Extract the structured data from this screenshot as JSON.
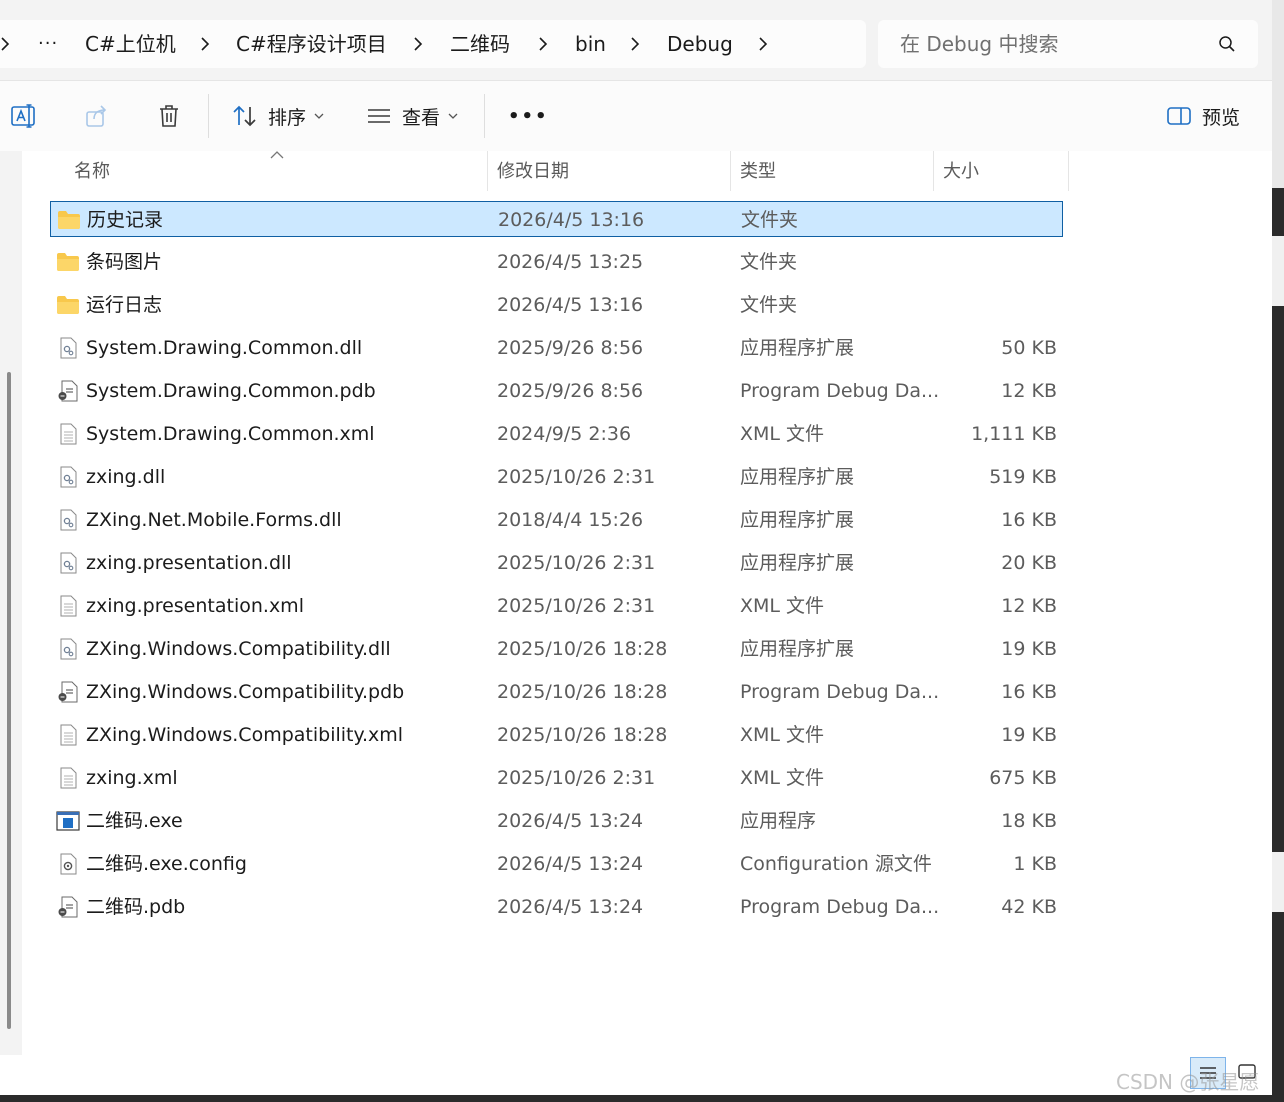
{
  "address_bar": {
    "crumbs": [
      "C#上位机",
      "C#程序设计项目",
      "二维码",
      "bin",
      "Debug"
    ],
    "overflow": "···"
  },
  "search": {
    "placeholder": "在 Debug 中搜索"
  },
  "toolbar": {
    "sort_label": "排序",
    "view_label": "查看",
    "more_label": "•••",
    "preview_label": "预览"
  },
  "columns": {
    "name": "名称",
    "date": "修改日期",
    "type": "类型",
    "size": "大小"
  },
  "files": [
    {
      "icon": "folder-icon",
      "name": "历史记录",
      "date": "2026/4/5 13:16",
      "type": "文件夹",
      "size": "",
      "selected": true
    },
    {
      "icon": "folder-icon",
      "name": "条码图片",
      "date": "2026/4/5 13:25",
      "type": "文件夹",
      "size": ""
    },
    {
      "icon": "folder-icon",
      "name": "运行日志",
      "date": "2026/4/5 13:16",
      "type": "文件夹",
      "size": ""
    },
    {
      "icon": "dll-file-icon",
      "name": "System.Drawing.Common.dll",
      "date": "2025/9/26 8:56",
      "type": "应用程序扩展",
      "size": "50 KB"
    },
    {
      "icon": "pdb-file-icon",
      "name": "System.Drawing.Common.pdb",
      "date": "2025/9/26 8:56",
      "type": "Program Debug Da...",
      "size": "12 KB"
    },
    {
      "icon": "text-file-icon",
      "name": "System.Drawing.Common.xml",
      "date": "2024/9/5 2:36",
      "type": "XML 文件",
      "size": "1,111 KB"
    },
    {
      "icon": "dll-file-icon",
      "name": "zxing.dll",
      "date": "2025/10/26 2:31",
      "type": "应用程序扩展",
      "size": "519 KB"
    },
    {
      "icon": "dll-file-icon",
      "name": "ZXing.Net.Mobile.Forms.dll",
      "date": "2018/4/4 15:26",
      "type": "应用程序扩展",
      "size": "16 KB"
    },
    {
      "icon": "dll-file-icon",
      "name": "zxing.presentation.dll",
      "date": "2025/10/26 2:31",
      "type": "应用程序扩展",
      "size": "20 KB"
    },
    {
      "icon": "text-file-icon",
      "name": "zxing.presentation.xml",
      "date": "2025/10/26 2:31",
      "type": "XML 文件",
      "size": "12 KB"
    },
    {
      "icon": "dll-file-icon",
      "name": "ZXing.Windows.Compatibility.dll",
      "date": "2025/10/26 18:28",
      "type": "应用程序扩展",
      "size": "19 KB"
    },
    {
      "icon": "pdb-file-icon",
      "name": "ZXing.Windows.Compatibility.pdb",
      "date": "2025/10/26 18:28",
      "type": "Program Debug Da...",
      "size": "16 KB"
    },
    {
      "icon": "text-file-icon",
      "name": "ZXing.Windows.Compatibility.xml",
      "date": "2025/10/26 18:28",
      "type": "XML 文件",
      "size": "19 KB"
    },
    {
      "icon": "text-file-icon",
      "name": "zxing.xml",
      "date": "2025/10/26 2:31",
      "type": "XML 文件",
      "size": "675 KB"
    },
    {
      "icon": "exe-file-icon",
      "name": "二维码.exe",
      "date": "2026/4/5 13:24",
      "type": "应用程序",
      "size": "18 KB"
    },
    {
      "icon": "config-file-icon",
      "name": "二维码.exe.config",
      "date": "2026/4/5 13:24",
      "type": "Configuration 源文件",
      "size": "1 KB"
    },
    {
      "icon": "pdb-file-icon",
      "name": "二维码.pdb",
      "date": "2026/4/5 13:24",
      "type": "Program Debug Da...",
      "size": "42 KB"
    }
  ],
  "watermark": "CSDN @张星愿"
}
